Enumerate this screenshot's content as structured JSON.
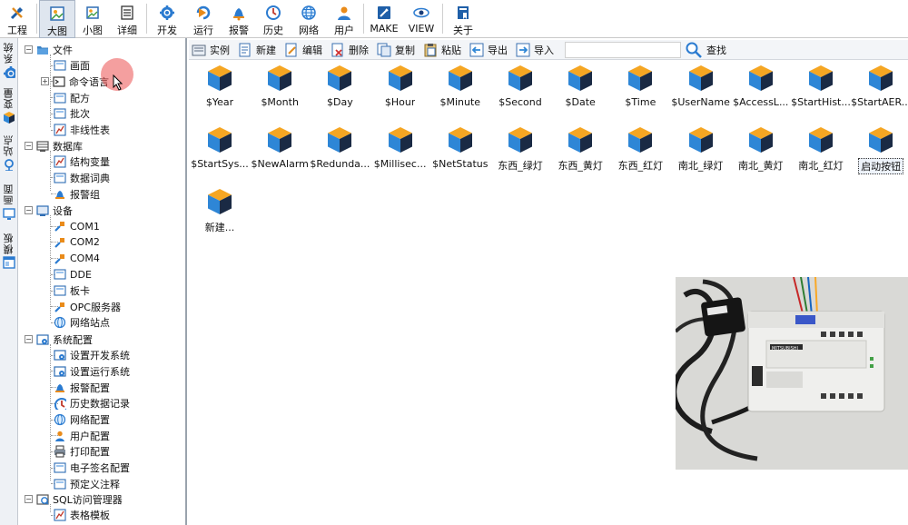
{
  "toolbar": {
    "items": [
      {
        "label": "工程",
        "icon": "tools-icon"
      },
      {
        "label": "大图",
        "icon": "large-view-icon",
        "active": true
      },
      {
        "label": "小图",
        "icon": "small-view-icon"
      },
      {
        "label": "详细",
        "icon": "details-view-icon"
      },
      {
        "label": "开发",
        "icon": "gear-icon"
      },
      {
        "label": "运行",
        "icon": "run-icon"
      },
      {
        "label": "报警",
        "icon": "bell-icon"
      },
      {
        "label": "历史",
        "icon": "clock-icon"
      },
      {
        "label": "网络",
        "icon": "globe-icon"
      },
      {
        "label": "用户",
        "icon": "user-icon"
      },
      {
        "label": "MAKE",
        "icon": "make-icon"
      },
      {
        "label": "VIEW",
        "icon": "eye-icon"
      },
      {
        "label": "关于",
        "icon": "book-icon"
      }
    ]
  },
  "vtabs": [
    {
      "label": "系统",
      "icon": "gear-icon"
    },
    {
      "label": "变量",
      "icon": "cube-icon"
    },
    {
      "label": "站点",
      "icon": "station-icon"
    },
    {
      "label": "画面",
      "icon": "screen-icon"
    },
    {
      "label": "模板",
      "icon": "template-icon"
    }
  ],
  "tree": {
    "file": {
      "label": "文件",
      "children": [
        "画面",
        "命令语言",
        "配方",
        "批次",
        "非线性表"
      ]
    },
    "database": {
      "label": "数据库",
      "children": [
        "结构变量",
        "数据词典",
        "报警组"
      ]
    },
    "device": {
      "label": "设备",
      "children": [
        "COM1",
        "COM2",
        "COM4",
        "DDE",
        "板卡",
        "OPC服务器",
        "网络站点"
      ]
    },
    "sysconfig": {
      "label": "系统配置",
      "children": [
        "设置开发系统",
        "设置运行系统",
        "报警配置",
        "历史数据记录",
        "网络配置",
        "用户配置",
        "打印配置",
        "电子签名配置",
        "预定义注释"
      ]
    },
    "sql": {
      "label": "SQL访问管理器",
      "children": [
        "表格模板"
      ]
    }
  },
  "content_toolbar": {
    "items": [
      {
        "label": "实例",
        "icon": "instance-icon"
      },
      {
        "label": "新建",
        "icon": "new-icon"
      },
      {
        "label": "编辑",
        "icon": "edit-icon"
      },
      {
        "label": "删除",
        "icon": "delete-icon"
      },
      {
        "label": "复制",
        "icon": "copy-icon"
      },
      {
        "label": "粘贴",
        "icon": "paste-icon"
      },
      {
        "label": "导出",
        "icon": "export-icon"
      },
      {
        "label": "导入",
        "icon": "import-icon"
      }
    ],
    "search_label": "查找",
    "search_value": ""
  },
  "variables": [
    "$Year",
    "$Month",
    "$Day",
    "$Hour",
    "$Minute",
    "$Second",
    "$Date",
    "$Time",
    "$UserName",
    "$AccessL...",
    "$StartHist...",
    "$StartAER...",
    "$StartSys...",
    "$NewAlarm",
    "$Redunda...",
    "$Millisec...",
    "$NetStatus",
    "东西_绿灯",
    "东西_黄灯",
    "东西_红灯",
    "南北_绿灯",
    "南北_黄灯",
    "南北_红灯",
    "启动按钮",
    "新建..."
  ],
  "selected_variable": "启动按钮",
  "webcam": {
    "plc_brand": "MITSUBISHI"
  },
  "colors": {
    "cube_top": "#f5a623",
    "cube_front": "#2e86d6",
    "cube_side": "#1a2a44",
    "folder": "#3b82c4"
  }
}
